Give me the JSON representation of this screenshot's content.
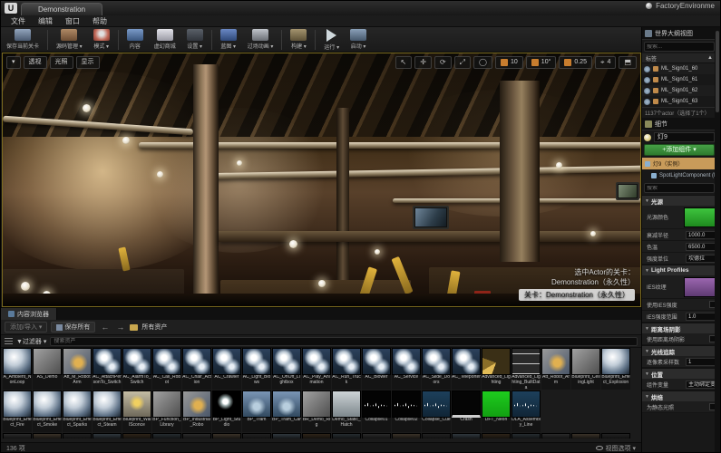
{
  "window": {
    "level_tab": "Demonstration",
    "title_right": "FactoryEnvironme",
    "logo": "U"
  },
  "menu": {
    "items": [
      "文件",
      "编辑",
      "窗口",
      "帮助"
    ]
  },
  "toolbar": {
    "buttons": [
      {
        "label": "保存当前关卡",
        "icon": "save-icon",
        "dropdown": false
      },
      {
        "label": "源码管理",
        "icon": "source-control-icon",
        "dropdown": true
      },
      {
        "label": "模式",
        "icon": "modes-icon",
        "dropdown": true
      },
      {
        "label": "内容",
        "icon": "content-icon",
        "dropdown": false
      },
      {
        "label": "虚幻商城",
        "icon": "marketplace-icon",
        "dropdown": false
      },
      {
        "label": "设置",
        "icon": "settings-icon",
        "dropdown": true
      },
      {
        "label": "蓝图",
        "icon": "blueprints-icon",
        "dropdown": true
      },
      {
        "label": "过场动画",
        "icon": "cinematics-icon",
        "dropdown": true
      },
      {
        "label": "构建",
        "icon": "build-icon",
        "dropdown": true
      },
      {
        "label": "运行",
        "icon": "play-icon",
        "dropdown": true
      },
      {
        "label": "启动",
        "icon": "launch-icon",
        "dropdown": true
      }
    ]
  },
  "viewport": {
    "left_controls": [
      "透视",
      "光照",
      "显示"
    ],
    "gizmos": [
      "select",
      "move",
      "rotate",
      "scale",
      "world"
    ],
    "snap": {
      "grid": "10",
      "rotate": "10°",
      "scale": "0.25",
      "camera": "4"
    },
    "overlay": {
      "line1": "选中Actor的关卡：",
      "line2": "Demonstration（永久性）",
      "current_level": "关卡：Demonstration（永久性）"
    }
  },
  "outliner": {
    "tab": "世界大纲视图",
    "search_placeholder": "搜索...",
    "column_header": "标签",
    "sort_icon": "▲",
    "rows": [
      "ML_Sign01_60",
      "ML_Sign01_61",
      "ML_Sign01_62",
      "ML_Sign01_63"
    ],
    "footer": "1137个actor（选择了1个）"
  },
  "details": {
    "tab": "细节",
    "actor_name": "灯9",
    "add_component_label": "+添加组件 ▾",
    "search_placeholder": "搜索",
    "tree": [
      {
        "label": "灯9（实例）",
        "selected": true
      },
      {
        "label": "SpotLightComponent (Light…)",
        "selected": false
      }
    ],
    "categories": [
      {
        "title": "光源",
        "rows": [
          {
            "label": "光源颜色",
            "widget": "swatch-green"
          },
          {
            "label": "衰减半径",
            "widget": "value",
            "value": "1000.0"
          },
          {
            "label": "色温",
            "widget": "value",
            "value": "6500.0"
          },
          {
            "label": "强度单位",
            "widget": "value",
            "value": "坎德拉"
          }
        ]
      },
      {
        "title": "Light Profiles",
        "rows": [
          {
            "label": "IES纹理",
            "widget": "swatch-purple"
          },
          {
            "label": "使用IES强度",
            "widget": "checkbox"
          },
          {
            "label": "IES强度范围",
            "widget": "value",
            "value": "1.0"
          }
        ]
      },
      {
        "title": "距离场阴影",
        "rows": [
          {
            "label": "使用距离场阴影",
            "widget": "checkbox"
          }
        ]
      },
      {
        "title": "光线追踪",
        "rows": [
          {
            "label": "逐像素采样数",
            "widget": "value",
            "value": "1"
          }
        ]
      },
      {
        "title": "位置",
        "rows": [
          {
            "label": "组件变量",
            "widget": "value",
            "value": "主动绑定变换"
          }
        ]
      },
      {
        "title": "烘焙",
        "rows": [
          {
            "label": "为静态光照",
            "widget": "checkbox"
          }
        ]
      }
    ]
  },
  "content_browser": {
    "tab": "内容浏览器",
    "add_import_label": "添加/导入 ▾",
    "save_all_label": "保存所有",
    "back": "←",
    "forward": "→",
    "path": "所有资产",
    "filters_label": "▼过滤器 ▾",
    "search_placeholder": "搜索资产",
    "footer_count": "136 项",
    "view_options_label": "视图选项 ▾",
    "assets_row1": [
      {
        "name": "A_Ambient_NonLoop",
        "type": "sphere"
      },
      {
        "name": "AS_Demo",
        "type": "img"
      },
      {
        "name": "Att_M_RobotArm",
        "type": "imggold"
      },
      {
        "name": "AC_AttachPersonTo_Switch",
        "type": "pair"
      },
      {
        "name": "AC_AlarmTo_Switch",
        "type": "pair"
      },
      {
        "name": "AC_Call_Robot",
        "type": "pair"
      },
      {
        "name": "AC_Chair_Action",
        "type": "pair"
      },
      {
        "name": "AC_Crawler",
        "type": "pair"
      },
      {
        "name": "AC_Light_Blows",
        "type": "pair"
      },
      {
        "name": "AC_OnOff_Lightbox",
        "type": "pair"
      },
      {
        "name": "AC_Play_Animation",
        "type": "pair"
      },
      {
        "name": "AC_Run_Truck",
        "type": "pair"
      },
      {
        "name": "AC_Blower",
        "type": "pair"
      },
      {
        "name": "AC_Service",
        "type": "pair"
      },
      {
        "name": "AC_Slide_Doors",
        "type": "pair"
      },
      {
        "name": "AC_Teleporter",
        "type": "pair"
      },
      {
        "name": "Advanced_Lighting",
        "type": "map"
      },
      {
        "name": "Advanced_Lighting_BuiltData",
        "type": "text"
      },
      {
        "name": "Att_Robot_Arm",
        "type": "imggold"
      },
      {
        "name": "Blueprint_CeilingLight",
        "type": "img"
      },
      {
        "name": "Blueprint_Effect_Explosion",
        "type": "sphere"
      }
    ],
    "assets_row2": [
      {
        "name": "Blueprint_Effect_Fire",
        "type": "sphere"
      },
      {
        "name": "Blueprint_Effect_Smoke",
        "type": "sphere"
      },
      {
        "name": "Blueprint_Effect_Sparks",
        "type": "sphere"
      },
      {
        "name": "Blueprint_Effect_Steam",
        "type": "sphere"
      },
      {
        "name": "Blueprint_WallSconce",
        "type": "imglamp"
      },
      {
        "name": "BP_Function_Library",
        "type": "img"
      },
      {
        "name": "BP_Industrial_Robo",
        "type": "imggold"
      },
      {
        "name": "BP_Light_Studio",
        "type": "blacksphere"
      },
      {
        "name": "BP_Tram",
        "type": "imgblue"
      },
      {
        "name": "BP_Tram_Car",
        "type": "imgblue"
      },
      {
        "name": "BR_Demo_Rig",
        "type": "img"
      },
      {
        "name": "Demo_Static_Hatch",
        "type": "imggrey"
      },
      {
        "name": "Collapse01",
        "type": "wave"
      },
      {
        "name": "Collapse02",
        "type": "wave"
      },
      {
        "name": "Collapse_Cue",
        "type": "cue"
      },
      {
        "name": "Crash",
        "type": "black"
      },
      {
        "name": "DFT_Neon",
        "type": "green"
      },
      {
        "name": "DLA_Assembly_Line",
        "type": "cue"
      }
    ]
  },
  "colors": {
    "accent_green": "#2e7a2e",
    "selection_tan": "#c89b5a",
    "viewport_border": "#7a6a1e",
    "snap_orange": "#c87d2e"
  }
}
